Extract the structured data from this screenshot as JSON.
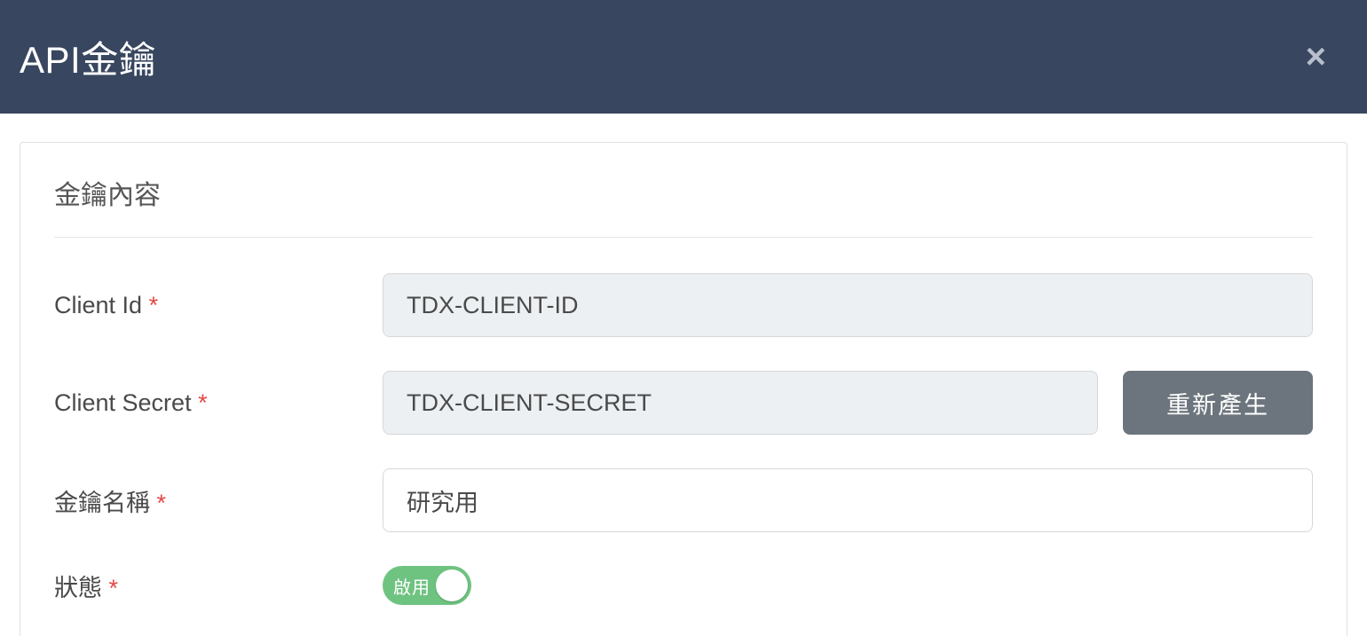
{
  "header": {
    "title": "API金鑰"
  },
  "section": {
    "title": "金鑰內容"
  },
  "fields": {
    "client_id": {
      "label": "Client Id",
      "value": "TDX-CLIENT-ID"
    },
    "client_secret": {
      "label": "Client Secret",
      "value": "TDX-CLIENT-SECRET",
      "regenerate": "重新產生"
    },
    "key_name": {
      "label": "金鑰名稱",
      "value": "研究用"
    },
    "status": {
      "label": "狀態",
      "toggle_label": "啟用"
    }
  },
  "required_marker": "*"
}
